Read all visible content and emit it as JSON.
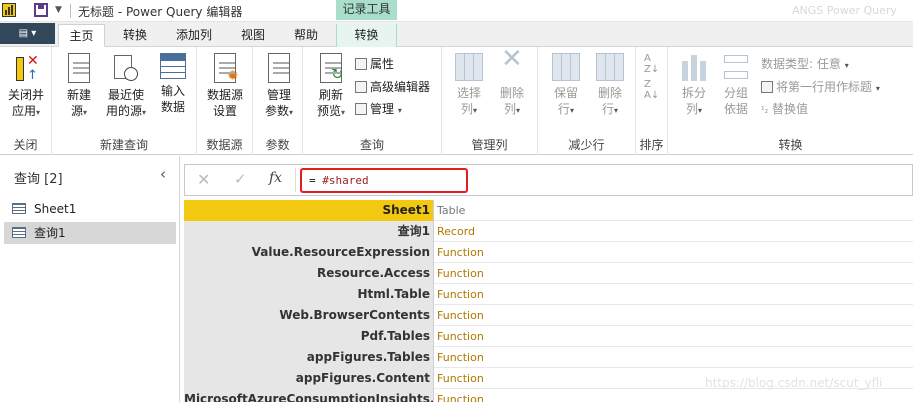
{
  "titlebar": {
    "doc_title": "无标题 - Power Query 编辑器",
    "context_group": "记录工具",
    "right_text": "ANGS Power Query"
  },
  "tabs": {
    "file": "▤ ▾",
    "items": [
      "主页",
      "转换",
      "添加列",
      "视图",
      "帮助",
      "转换"
    ],
    "active": "主页"
  },
  "ribbon": {
    "groups": {
      "close": "关闭",
      "new_query": "新建查询",
      "data_source": "数据源",
      "params": "参数",
      "query": "查询",
      "manage_cols": "管理列",
      "reduce_rows": "减少行",
      "sort": "排序",
      "transform": "转换"
    },
    "buttons": {
      "close_apply_1": "关闭并",
      "close_apply_2": "应用",
      "new_source_1": "新建",
      "new_source_2": "源",
      "recent_1": "最近使",
      "recent_2": "用的源",
      "enter_1": "输入",
      "enter_2": "数据",
      "ds_settings_1": "数据源",
      "ds_settings_2": "设置",
      "manage_params_1": "管理",
      "manage_params_2": "参数",
      "refresh_1": "刷新",
      "refresh_2": "预览",
      "properties": "属性",
      "advanced_editor": "高级编辑器",
      "manage": "管理",
      "choose_cols_1": "选择",
      "choose_cols_2": "列",
      "remove_cols_1": "删除",
      "remove_cols_2": "列",
      "keep_rows_1": "保留",
      "keep_rows_2": "行",
      "remove_rows_1": "删除",
      "remove_rows_2": "行",
      "split_1": "拆分",
      "split_2": "列",
      "group_1": "分组",
      "group_2": "依据",
      "data_type": "数据类型: 任意",
      "first_row_header": "将第一行用作标题",
      "replace_values": "替换值"
    }
  },
  "left_pane": {
    "title": "查询 [2]",
    "queries": [
      {
        "name": "Sheet1",
        "selected": false
      },
      {
        "name": "查询1",
        "selected": true
      }
    ]
  },
  "formula": {
    "prefix": "= ",
    "expr": "#shared"
  },
  "table": {
    "rows": [
      {
        "name": "Sheet1",
        "value": "Table"
      },
      {
        "name": "查询1",
        "value": "Record"
      },
      {
        "name": "Value.ResourceExpression",
        "value": "Function"
      },
      {
        "name": "Resource.Access",
        "value": "Function"
      },
      {
        "name": "Html.Table",
        "value": "Function"
      },
      {
        "name": "Web.BrowserContents",
        "value": "Function"
      },
      {
        "name": "Pdf.Tables",
        "value": "Function"
      },
      {
        "name": "appFigures.Tables",
        "value": "Function"
      },
      {
        "name": "appFigures.Content",
        "value": "Function"
      },
      {
        "name": "MicrosoftAzureConsumptionInsights.Contents",
        "value": "Function"
      }
    ]
  },
  "watermark": "https://blog.csdn.net/scut_yfli",
  "colors": {
    "accent_yellow": "#f2c811",
    "highlight_box": "#e02020",
    "context_tab": "#a7dfcb"
  }
}
